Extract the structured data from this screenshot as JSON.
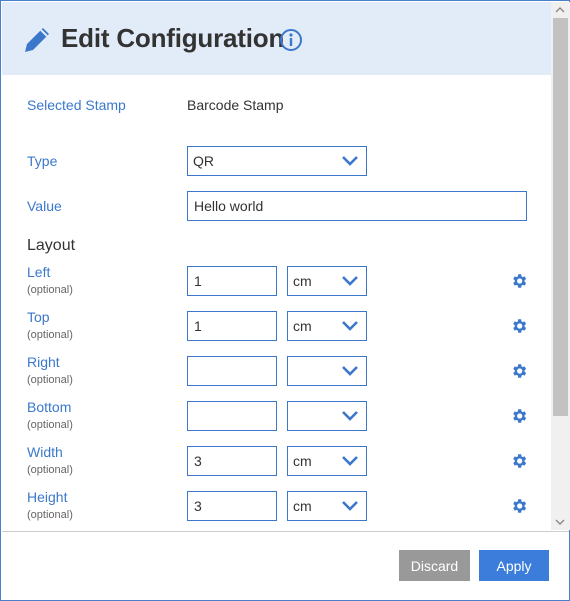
{
  "header": {
    "title": "Edit Configuration",
    "icons": {
      "edit": "pencil-icon",
      "help": "info-icon"
    }
  },
  "selected_stamp": {
    "label": "Selected Stamp",
    "value": "Barcode Stamp"
  },
  "type": {
    "label": "Type",
    "value": "QR"
  },
  "value_field": {
    "label": "Value",
    "value": "Hello world"
  },
  "layout": {
    "title": "Layout",
    "optional_text": "(optional)",
    "rows": [
      {
        "label": "Left",
        "value": "1",
        "unit": "cm"
      },
      {
        "label": "Top",
        "value": "1",
        "unit": "cm"
      },
      {
        "label": "Right",
        "value": "",
        "unit": ""
      },
      {
        "label": "Bottom",
        "value": "",
        "unit": ""
      },
      {
        "label": "Width",
        "value": "3",
        "unit": "cm"
      },
      {
        "label": "Height",
        "value": "3",
        "unit": "cm"
      }
    ]
  },
  "footer": {
    "discard_label": "Discard",
    "apply_label": "Apply"
  },
  "colors": {
    "accent": "#3b78cc",
    "header_bg": "#e1ecf8",
    "discard_bg": "#999999",
    "apply_bg": "#3c7ddb"
  }
}
